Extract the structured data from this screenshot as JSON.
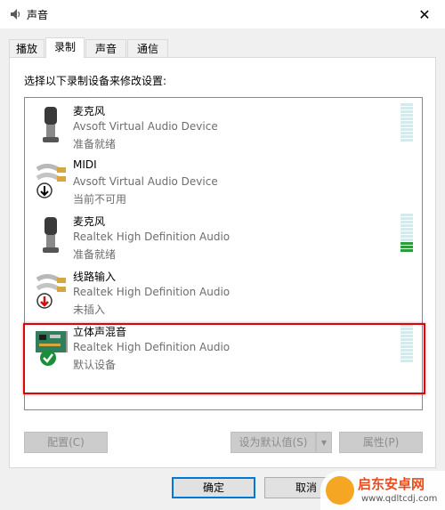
{
  "window": {
    "title": "声音",
    "close_glyph": "✕"
  },
  "tabs": [
    {
      "label": "播放",
      "active": false
    },
    {
      "label": "录制",
      "active": true
    },
    {
      "label": "声音",
      "active": false
    },
    {
      "label": "通信",
      "active": false
    }
  ],
  "instruction": "选择以下录制设备来修改设置:",
  "devices": [
    {
      "name": "麦克风",
      "driver": "Avsoft Virtual Audio Device",
      "status": "准备就绪",
      "icon": "microphone-icon",
      "meter_level": 0
    },
    {
      "name": "MIDI",
      "driver": "Avsoft Virtual Audio Device",
      "status": "当前不可用",
      "icon": "audio-jack-unavailable-icon",
      "meter_level": null
    },
    {
      "name": "麦克风",
      "driver": "Realtek High Definition Audio",
      "status": "准备就绪",
      "icon": "microphone-icon",
      "meter_level": 0.3
    },
    {
      "name": "线路输入",
      "driver": "Realtek High Definition Audio",
      "status": "未插入",
      "icon": "audio-jack-unplugged-icon",
      "meter_level": null
    },
    {
      "name": "立体声混音",
      "driver": "Realtek High Definition Audio",
      "status": "默认设备",
      "icon": "sound-card-default-icon",
      "meter_level": 0
    }
  ],
  "buttons": {
    "configure": "配置(C)",
    "set_default": "设为默认值(S)",
    "set_default_arrow": "▾",
    "properties": "属性(P)",
    "ok": "确定",
    "cancel": "取消"
  },
  "watermark": {
    "text": "启东安卓网",
    "url": "www.qdltcdj.com"
  },
  "colors": {
    "accent": "#0078d7",
    "highlight": "#d20a0a",
    "meter_active": "#2d9b3b",
    "meter_idle": "#d6e9ec"
  }
}
